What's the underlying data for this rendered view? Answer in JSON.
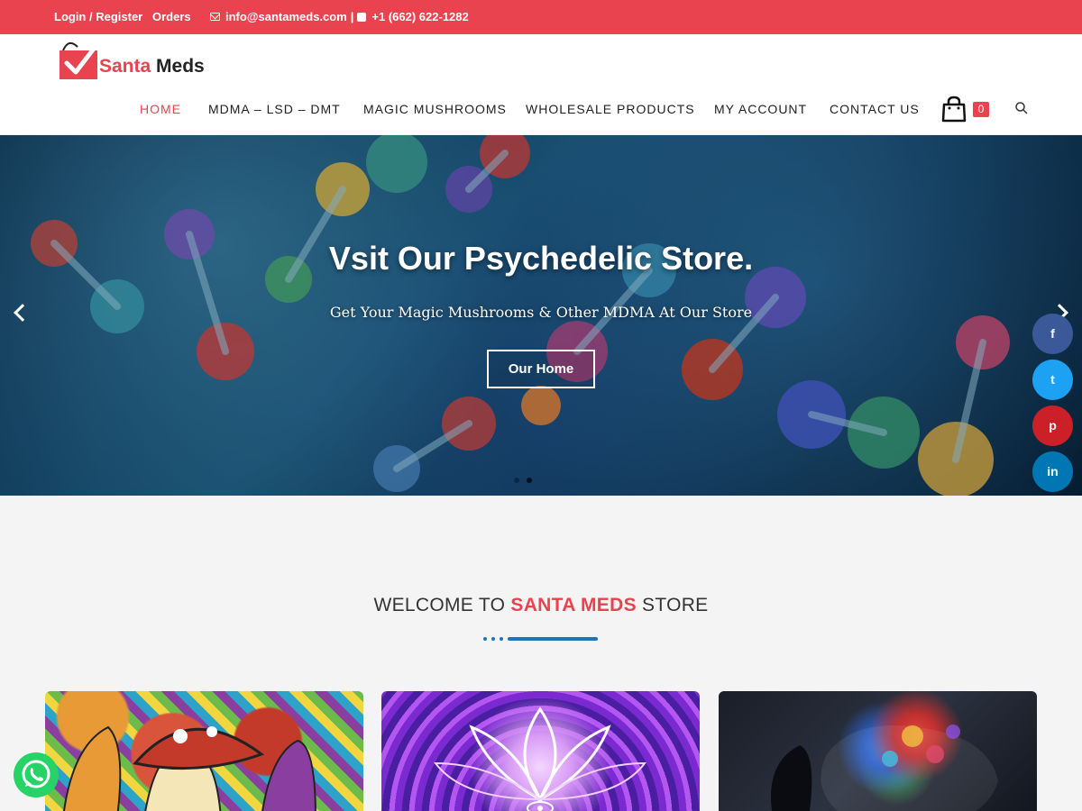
{
  "topbar": {
    "login_label": "Login / Register",
    "orders_label": "Orders",
    "email": "info@santameds.com",
    "separator": "|",
    "phone": "+1 (662) 622-1282",
    "background_color": "#e8434f"
  },
  "logo": {
    "text_part1": "Santa",
    "text_part2": " Meds"
  },
  "nav": {
    "items": [
      {
        "label": "HOME",
        "active": true
      },
      {
        "label": "MDMA – LSD – DMT",
        "active": false
      },
      {
        "label": "MAGIC MUSHROOMS",
        "active": false
      },
      {
        "label": "WHOLESALE PRODUCTS",
        "active": false
      },
      {
        "label": "MY ACCOUNT",
        "active": false
      },
      {
        "label": "CONTACT US",
        "active": false
      }
    ],
    "cart_count": "0",
    "cart_icon": "shopping-bag-icon",
    "search_icon": "search-icon",
    "accent_color": "#e8434f"
  },
  "hero": {
    "title": "Vsit Our Psychedelic Store.",
    "subtitle": "Get Your Magic Mushrooms & Other MDMA At Our Store",
    "button_label": "Our Home",
    "prev_icon": "chevron-left-icon",
    "next_icon": "chevron-right-icon",
    "slide_count": 2,
    "active_slide": 2
  },
  "social": {
    "facebook": "f",
    "twitter": "t",
    "pinterest": "p",
    "linkedin": "in"
  },
  "welcome": {
    "prefix": "WELCOME TO ",
    "brand": "SANTA MEDS",
    "suffix": " STORE",
    "brand_color": "#e8434f",
    "divider_color": "#1e73be"
  },
  "cards": [
    {
      "image": "psychedelic-mushrooms-art"
    },
    {
      "image": "purple-lotus-mandala-art"
    },
    {
      "image": "colorful-brain-silhouette-art"
    }
  ],
  "whatsapp_icon": "whatsapp-icon"
}
